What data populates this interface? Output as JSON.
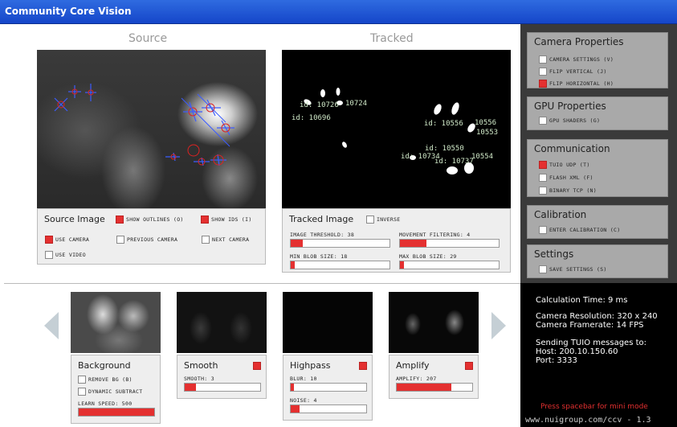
{
  "app": {
    "title": "Community Core Vision"
  },
  "source": {
    "heading": "Source",
    "image_label": "Source Image",
    "show_outlines": {
      "label": "SHOW OUTLINES (O)",
      "checked": true
    },
    "show_ids": {
      "label": "SHOW IDS (I)",
      "checked": true
    },
    "use_camera": {
      "label": "USE CAMERA",
      "checked": true
    },
    "previous_camera": {
      "label": "PREVIOUS CAMERA",
      "checked": false
    },
    "next_camera": {
      "label": "NEXT CAMERA",
      "checked": false
    },
    "use_video": {
      "label": "USE VIDEO",
      "checked": false
    }
  },
  "tracked": {
    "heading": "Tracked",
    "image_label": "Tracked Image",
    "inverse": {
      "label": "INVERSE",
      "checked": false
    },
    "blob_ids": [
      "id: 10726",
      "10724",
      "id: 10696",
      "id: 10556",
      "10556",
      "10553",
      "id: 10550",
      "id: 10734",
      "id: 10737",
      "10554"
    ],
    "sliders": {
      "image_threshold": {
        "label": "IMAGE THRESHOLD: 38",
        "level": 0.12
      },
      "movement_filtering": {
        "label": "MOVEMENT FILTERING: 4",
        "level": 0.27
      },
      "min_blob_size": {
        "label": "MIN BLOB SIZE: 18",
        "level": 0.04
      },
      "max_blob_size": {
        "label": "MAX BLOB SIZE: 29",
        "level": 0.04
      }
    }
  },
  "camera_properties": {
    "title": "Camera Properties",
    "camera_settings": {
      "label": "CAMERA SETTINGS (V)",
      "checked": false
    },
    "flip_vertical": {
      "label": "FLIP VERTICAL (J)",
      "checked": false
    },
    "flip_horizontal": {
      "label": "FLIP HORIZONTAL (H)",
      "checked": true
    }
  },
  "gpu_properties": {
    "title": "GPU Properties",
    "gpu_shaders": {
      "label": "GPU SHADERS (G)",
      "checked": false
    }
  },
  "communication": {
    "title": "Communication",
    "tuio_udp": {
      "label": "TUIO UDP (T)",
      "checked": true
    },
    "flash_xml": {
      "label": "FLASH XML (F)",
      "checked": false
    },
    "binary_tcp": {
      "label": "BINARY TCP (N)",
      "checked": false
    }
  },
  "calibration": {
    "title": "Calibration",
    "enter_calibration": {
      "label": "ENTER CALIBRATION (C)",
      "checked": false
    }
  },
  "settings": {
    "title": "Settings",
    "save_settings": {
      "label": "SAVE SETTINGS (S)",
      "checked": false
    }
  },
  "filters": {
    "background": {
      "title": "Background",
      "remove_bg": {
        "label": "REMOVE BG (B)",
        "checked": false
      },
      "dynamic_subtract": {
        "label": "DYNAMIC SUBTRACT",
        "checked": false
      },
      "learn_speed": {
        "label": "LEARN SPEED: 500",
        "level": 1.0
      }
    },
    "smooth": {
      "title": "Smooth",
      "enabled": true,
      "smooth": {
        "label": "SMOOTH: 3",
        "level": 0.15
      }
    },
    "highpass": {
      "title": "Highpass",
      "enabled": true,
      "blur": {
        "label": "BLUR: 10",
        "level": 0.04
      },
      "noise": {
        "label": "NOISE: 4",
        "level": 0.12
      }
    },
    "amplify": {
      "title": "Amplify",
      "enabled": true,
      "amplify": {
        "label": "AMPLIFY: 207",
        "level": 0.72
      }
    }
  },
  "info": {
    "calculation_time": "Calculation Time:  9 ms",
    "camera_resolution": "Camera Resolution:  320 x 240",
    "camera_framerate": "Camera Framerate:  14 FPS",
    "sending_tuio": "Sending TUIO messages to:",
    "host": "Host:  200.10.150.60",
    "port": "Port:  3333",
    "spacebar_hint": "Press spacebar for mini mode",
    "url": "www.nuigroup.com/ccv - 1.3"
  },
  "colors": {
    "accent": "#e43030",
    "title_bar": "#1e57d6",
    "side_panel": "#3a3a3a",
    "side_box": "#a9a9a9"
  }
}
